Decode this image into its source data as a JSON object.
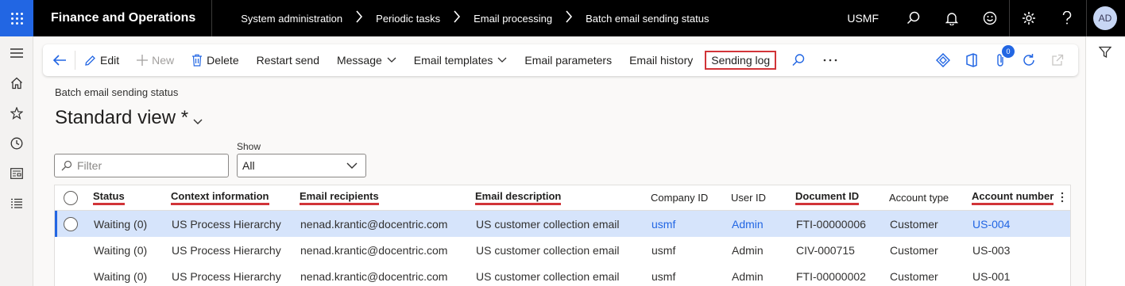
{
  "app": {
    "title": "Finance and Operations",
    "company": "USMF",
    "user_initials": "AD"
  },
  "breadcrumb": [
    "System administration",
    "Periodic tasks",
    "Email processing",
    "Batch email sending status"
  ],
  "actions": {
    "edit": "Edit",
    "new": "New",
    "delete": "Delete",
    "restart_send": "Restart send",
    "message": "Message",
    "email_templates": "Email templates",
    "email_parameters": "Email parameters",
    "email_history": "Email history",
    "sending_log": "Sending log",
    "attachments_count": "0"
  },
  "page": {
    "caption": "Batch email sending status",
    "view_title": "Standard view *"
  },
  "filter": {
    "placeholder": "Filter",
    "show_label": "Show",
    "show_value": "All"
  },
  "grid": {
    "columns": [
      "Status",
      "Context information",
      "Email recipients",
      "Email description",
      "Company ID",
      "User ID",
      "Document ID",
      "Account type",
      "Account number"
    ],
    "rows": [
      [
        "Waiting (0)",
        "US Process Hierarchy",
        "nenad.krantic@docentric.com",
        "US customer collection email",
        "usmf",
        "Admin",
        "FTI-00000006",
        "Customer",
        "US-004"
      ],
      [
        "Waiting (0)",
        "US Process Hierarchy",
        "nenad.krantic@docentric.com",
        "US customer collection email",
        "usmf",
        "Admin",
        "CIV-000715",
        "Customer",
        "US-003"
      ],
      [
        "Waiting (0)",
        "US Process Hierarchy",
        "nenad.krantic@docentric.com",
        "US customer collection email",
        "usmf",
        "Admin",
        "FTI-00000002",
        "Customer",
        "US-001"
      ]
    ]
  },
  "colors": {
    "accent": "#2266e3",
    "highlight": "#d13438",
    "selected_row": "#d6e4fb"
  }
}
